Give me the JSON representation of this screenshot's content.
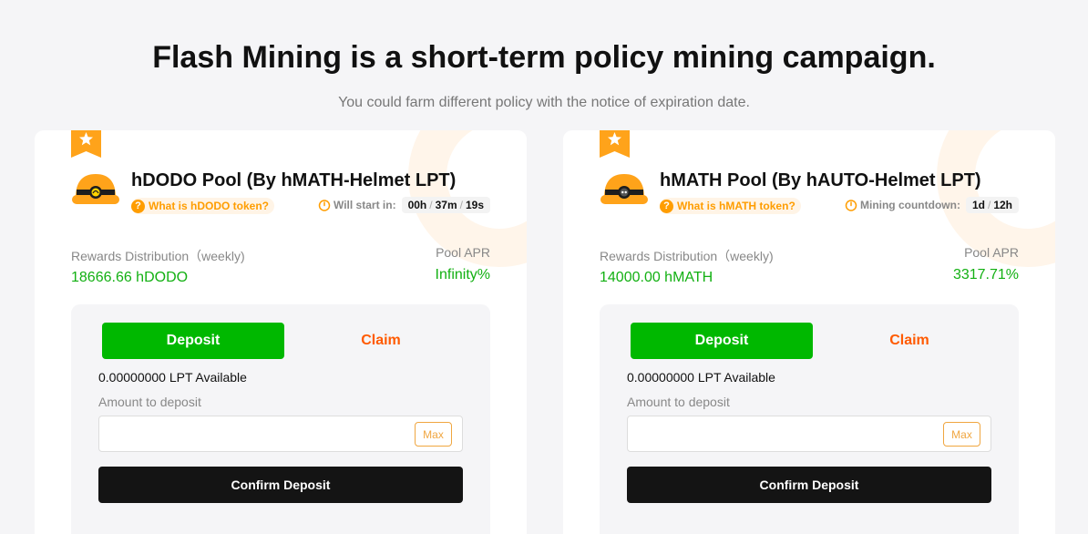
{
  "header": {
    "title": "Flash Mining is a short-term policy mining campaign.",
    "subtitle": "You could farm different policy with the notice of expiration date."
  },
  "colors": {
    "accent_green": "#00b800",
    "reward_green": "#12b012",
    "claim_orange": "#ff5a00",
    "link_orange": "#ff9d00",
    "confirm_black": "#141414"
  },
  "pools": [
    {
      "title": "hDODO Pool (By hMATH-Helmet LPT)",
      "what_link": "What is hDODO token?",
      "timer_label": "Will start in:",
      "timer": [
        "00h",
        "37m",
        "19s"
      ],
      "rewards_label": "Rewards Distribution（weekly)",
      "rewards_value": "18666.66 hDODO",
      "apr_label": "Pool APR",
      "apr_value": "Infinity%",
      "deposit_tab": "Deposit",
      "claim_tab": "Claim",
      "available": "0.00000000 LPT Available",
      "amount_label": "Amount to deposit",
      "amount_value": "",
      "max_label": "Max",
      "confirm_label": "Confirm Deposit",
      "icons": [
        "star-ribbon-icon",
        "helmet-icon",
        "question-icon",
        "clock-icon"
      ]
    },
    {
      "title": "hMATH Pool (By hAUTO-Helmet LPT)",
      "what_link": "What is hMATH token?",
      "timer_label": "Mining countdown:",
      "timer": [
        "1d",
        "12h"
      ],
      "rewards_label": "Rewards Distribution（weekly)",
      "rewards_value": "14000.00 hMATH",
      "apr_label": "Pool APR",
      "apr_value": "3317.71%",
      "deposit_tab": "Deposit",
      "claim_tab": "Claim",
      "available": "0.00000000 LPT Available",
      "amount_label": "Amount to deposit",
      "amount_value": "",
      "max_label": "Max",
      "confirm_label": "Confirm Deposit",
      "icons": [
        "star-ribbon-icon",
        "helmet-icon",
        "question-icon",
        "clock-icon"
      ]
    }
  ]
}
